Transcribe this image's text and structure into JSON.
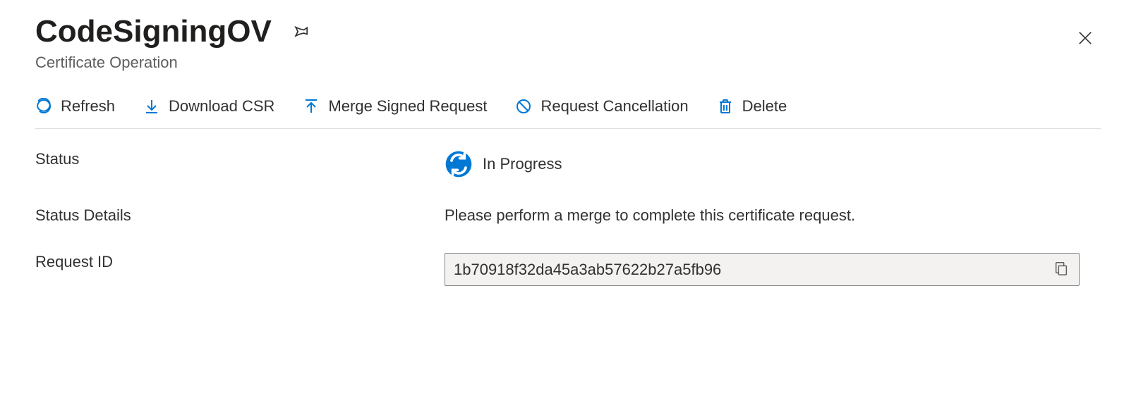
{
  "header": {
    "title": "CodeSigningOV",
    "subtitle": "Certificate Operation"
  },
  "toolbar": {
    "refresh": "Refresh",
    "download_csr": "Download CSR",
    "merge_signed": "Merge Signed Request",
    "request_cancellation": "Request Cancellation",
    "delete": "Delete"
  },
  "fields": {
    "status_label": "Status",
    "status_value": "In Progress",
    "status_details_label": "Status Details",
    "status_details_value": "Please perform a merge to complete this certificate request.",
    "request_id_label": "Request ID",
    "request_id_value": "1b70918f32da45a3ab57622b27a5fb96"
  }
}
